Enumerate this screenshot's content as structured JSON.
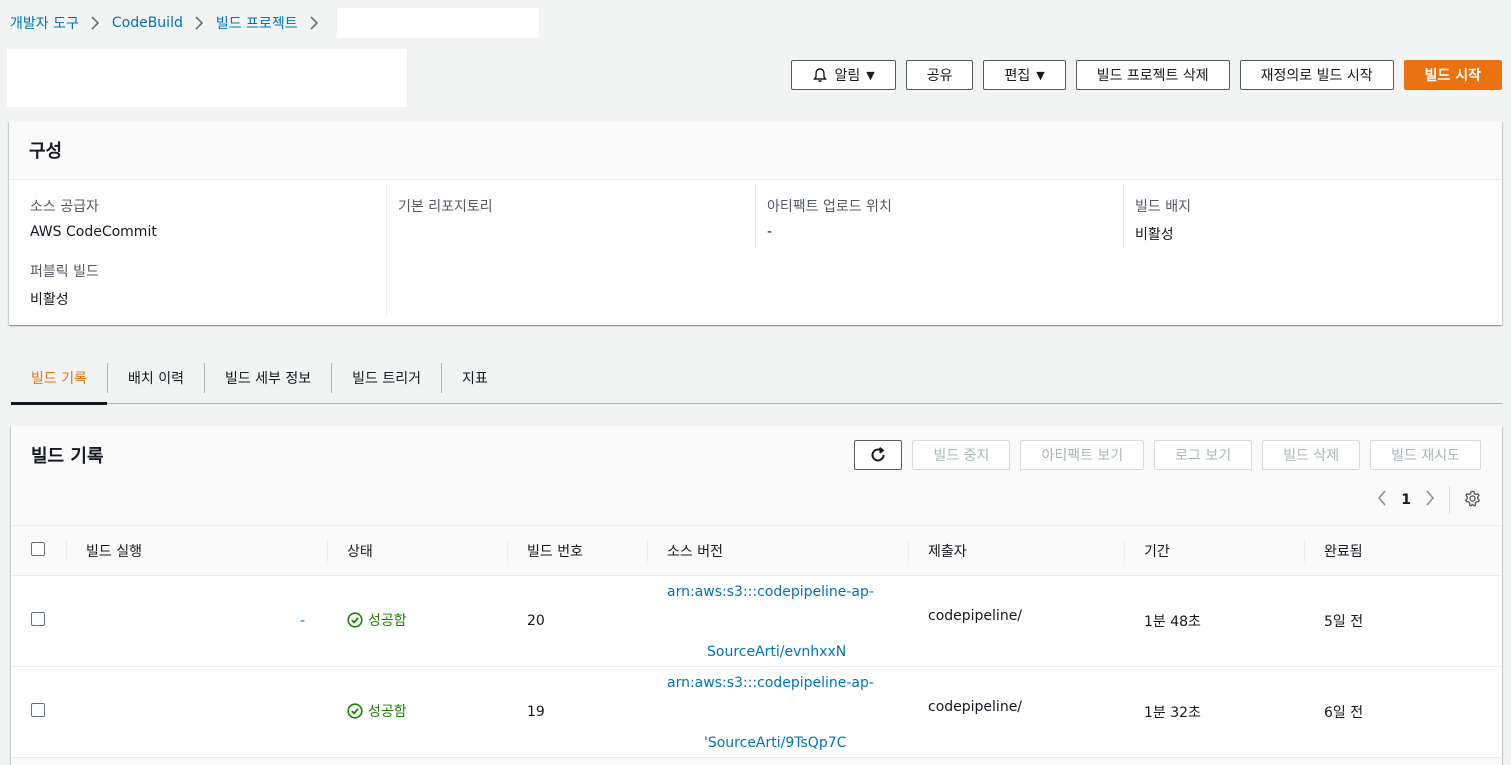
{
  "breadcrumb": {
    "items": [
      "개발자 도구",
      "CodeBuild",
      "빌드 프로젝트"
    ]
  },
  "header_actions": {
    "notify": "알림",
    "share": "공유",
    "edit": "편집",
    "delete_project": "빌드 프로젝트 삭제",
    "retry_build": "재정의로 빌드 시작",
    "start_build": "빌드 시작"
  },
  "config": {
    "title": "구성",
    "source_provider_label": "소스 공급자",
    "source_provider_value": "AWS CodeCommit",
    "repository_label": "기본 리포지토리",
    "artifact_label": "아티팩트 업로드 위치",
    "artifact_value": "-",
    "badge_label": "빌드 배지",
    "badge_value": "비활성",
    "public_build_label": "퍼블릭 빌드",
    "public_build_value": "비활성"
  },
  "tabs": [
    "빌드 기록",
    "배치 이력",
    "빌드 세부 정보",
    "빌드 트리거",
    "지표"
  ],
  "history": {
    "title": "빌드 기록",
    "actions": [
      "빌드 중지",
      "아티팩트 보기",
      "로그 보기",
      "빌드 삭제",
      "빌드 재시도"
    ],
    "page": "1",
    "columns": [
      "빌드 실행",
      "상태",
      "빌드 번호",
      "소스 버전",
      "제출자",
      "기간",
      "완료됨"
    ],
    "rows": [
      {
        "run": "-",
        "status": "성공함",
        "number": "20",
        "source_line1": "arn:aws:s3:::codepipeline-ap-",
        "source_line2": "SourceArti/evnhxxN",
        "submitter": "codepipeline/",
        "duration": "1분 48초",
        "completed": "5일 전"
      },
      {
        "run": "",
        "status": "성공함",
        "number": "19",
        "source_line1": "arn:aws:s3:::codepipeline-ap-",
        "source_line2": "'SourceArti/9TsQp7C",
        "submitter": "codepipeline/",
        "duration": "1분 32초",
        "completed": "6일 전"
      }
    ]
  },
  "colors": {
    "primary": "#ec7211",
    "link": "#0073bb",
    "success": "#1d8102",
    "background": "#f2f3f3"
  }
}
